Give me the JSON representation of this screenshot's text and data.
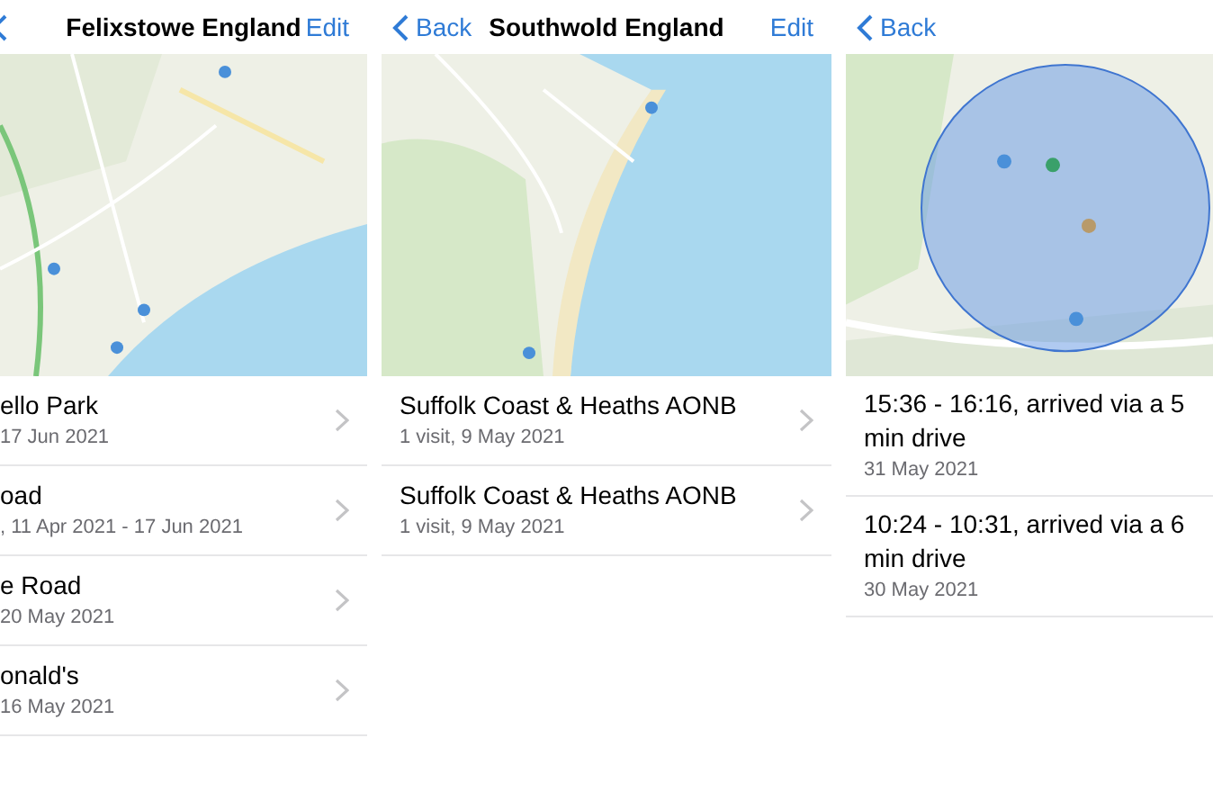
{
  "panels": [
    {
      "nav": {
        "back": true,
        "title": "Felixstowe England",
        "action": "Edit"
      },
      "map": {
        "kind": "picture"
      },
      "rows": [
        {
          "title": "ello Park",
          "subtitle": "17 Jun 2021",
          "chevron": true
        },
        {
          "title": "oad",
          "subtitle": ", 11 Apr 2021 - 17 Jun 2021",
          "chevron": true
        },
        {
          "title": "e Road",
          "subtitle": "20 May 2021",
          "chevron": true
        },
        {
          "title": "onald's",
          "subtitle": "16 May 2021",
          "chevron": true
        }
      ]
    },
    {
      "nav": {
        "back": true,
        "back_label": "Back",
        "title": "Southwold England",
        "action": "Edit"
      },
      "map": {
        "kind": "picture"
      },
      "rows": [
        {
          "title": "Suffolk Coast & Heaths AONB",
          "subtitle": "1 visit, 9 May 2021",
          "chevron": true
        },
        {
          "title": "Suffolk Coast & Heaths AONB",
          "subtitle": "1 visit, 9 May 2021",
          "chevron": true
        }
      ]
    },
    {
      "nav": {
        "back": true,
        "back_label": "Back"
      },
      "map": {
        "kind": "picture"
      },
      "rows": [
        {
          "title": "15:36 - 16:16, arrived via a 5 min drive",
          "subtitle": "31 May 2021",
          "chevron": false
        },
        {
          "title": "10:24 - 10:31, arrived via a 6 min drive",
          "subtitle": "30 May 2021",
          "chevron": false
        }
      ]
    }
  ]
}
